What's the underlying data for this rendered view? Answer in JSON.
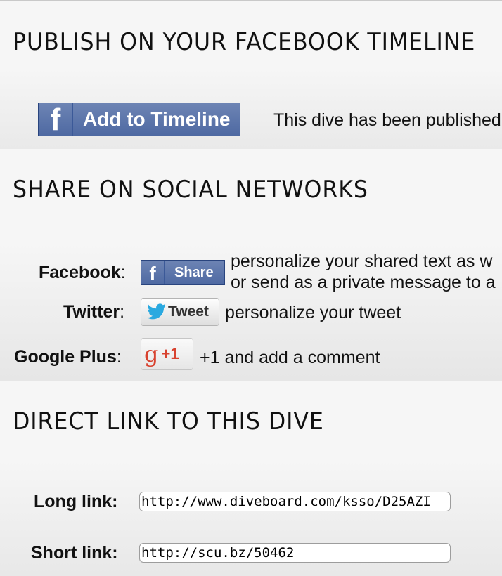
{
  "sections": {
    "publish": {
      "title": "PUBLISH ON YOUR FACEBOOK TIMELINE",
      "button_icon": "f",
      "button_label": "Add to Timeline",
      "status_text": "This dive has been published"
    },
    "share": {
      "title": "SHARE ON SOCIAL NETWORKS",
      "rows": [
        {
          "label": "Facebook",
          "colon": ":",
          "button_icon": "f",
          "button_label": "Share",
          "description_line1": "personalize your shared text as w",
          "description_line2": "or send as a private message to a"
        },
        {
          "label": "Twitter",
          "colon": ":",
          "button_label": "Tweet",
          "description": "personalize your tweet"
        },
        {
          "label": "Google Plus",
          "colon": ":",
          "button_icon": "g",
          "button_label": "+1",
          "description": "+1 and add a comment"
        }
      ]
    },
    "direct_link": {
      "title": "DIRECT LINK TO THIS DIVE",
      "long_label": "Long link:",
      "long_value": "http://www.diveboard.com/ksso/D25AZI",
      "short_label": "Short link:",
      "short_value": "http://scu.bz/50462"
    }
  },
  "colors": {
    "facebook_blue": "#4e69a2",
    "twitter_blue": "#2aa9e0",
    "google_red": "#d8422f"
  },
  "icons": {
    "facebook": "facebook-f-icon",
    "twitter": "twitter-bird-icon",
    "google": "google-g-icon"
  }
}
